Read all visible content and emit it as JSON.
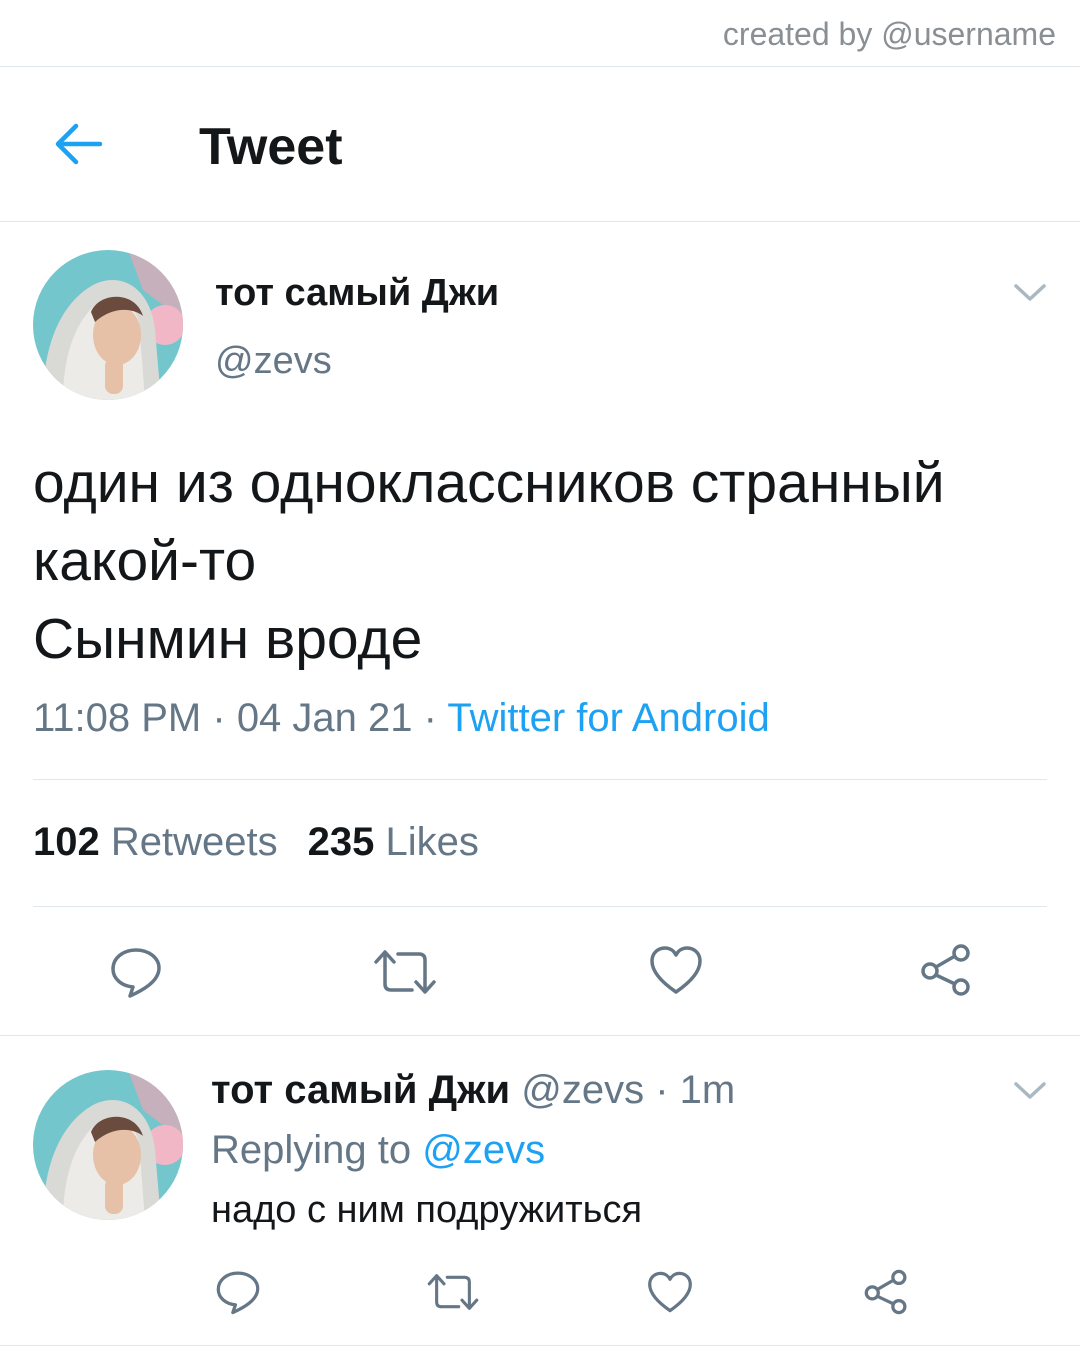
{
  "watermark": "created by @username",
  "header": {
    "title": "Tweet",
    "back_icon": "arrow-left-icon"
  },
  "tweet": {
    "author_name": "тот самый Джи",
    "author_handle": "@zevs",
    "text_lines": [
      "один из одноклассников странный",
      "какой-то",
      "Сынмин вроде"
    ],
    "time": "11:08 PM",
    "date": "04 Jan 21",
    "source": "Twitter for Android",
    "retweets_count": "102",
    "retweets_label": "Retweets",
    "likes_count": "235",
    "likes_label": "Likes"
  },
  "reply": {
    "author_name": "тот самый Джи",
    "author_handle": "@zevs",
    "age": "1m",
    "replying_prefix": "Replying to",
    "replying_mention": "@zevs",
    "text": "надо с ним подружиться"
  },
  "colors": {
    "accent": "#1da1f2",
    "muted": "#657786",
    "text": "#14171a",
    "border": "#e1e8ed"
  },
  "icons": [
    "arrow-left-icon",
    "chevron-down-icon",
    "reply-icon",
    "retweet-icon",
    "like-icon",
    "share-icon"
  ]
}
